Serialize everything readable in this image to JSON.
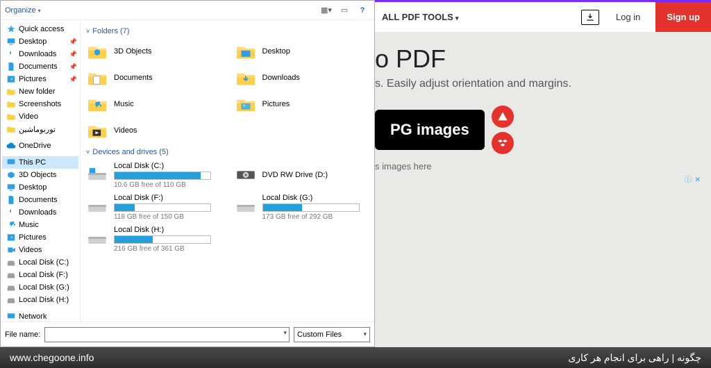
{
  "dialog": {
    "organize": "Organize",
    "view_btn": "▦",
    "preview_btn": "▭",
    "help_btn": "?",
    "nav": [
      {
        "label": "Quick access",
        "icon": "star",
        "pin": false
      },
      {
        "label": "Desktop",
        "icon": "desktop",
        "pin": true
      },
      {
        "label": "Downloads",
        "icon": "download",
        "pin": true
      },
      {
        "label": "Documents",
        "icon": "doc",
        "pin": true
      },
      {
        "label": "Pictures",
        "icon": "pic",
        "pin": true
      },
      {
        "label": "New folder",
        "icon": "folder",
        "pin": false
      },
      {
        "label": "Screenshots",
        "icon": "folder",
        "pin": false
      },
      {
        "label": "Video",
        "icon": "folder",
        "pin": false
      },
      {
        "label": "توربوماشین",
        "icon": "folder",
        "pin": false
      },
      {
        "label": "OneDrive",
        "icon": "cloud",
        "pin": false
      },
      {
        "label": "This PC",
        "icon": "pc",
        "pin": false,
        "selected": true
      },
      {
        "label": "3D Objects",
        "icon": "3d",
        "pin": false
      },
      {
        "label": "Desktop",
        "icon": "desktop",
        "pin": false
      },
      {
        "label": "Documents",
        "icon": "doc",
        "pin": false
      },
      {
        "label": "Downloads",
        "icon": "download",
        "pin": false
      },
      {
        "label": "Music",
        "icon": "music",
        "pin": false
      },
      {
        "label": "Pictures",
        "icon": "pic",
        "pin": false
      },
      {
        "label": "Videos",
        "icon": "video",
        "pin": false
      },
      {
        "label": "Local Disk (C:)",
        "icon": "drive",
        "pin": false
      },
      {
        "label": "Local Disk (F:)",
        "icon": "drive",
        "pin": false
      },
      {
        "label": "Local Disk (G:)",
        "icon": "drive",
        "pin": false
      },
      {
        "label": "Local Disk (H:)",
        "icon": "drive",
        "pin": false
      },
      {
        "label": "Network",
        "icon": "net",
        "pin": false
      }
    ],
    "folders_header": "Folders (7)",
    "folders": [
      {
        "label": "3D Objects",
        "icon": "3d"
      },
      {
        "label": "Desktop",
        "icon": "desktop-f"
      },
      {
        "label": "Documents",
        "icon": "doc-f"
      },
      {
        "label": "Downloads",
        "icon": "download-f"
      },
      {
        "label": "Music",
        "icon": "music-f"
      },
      {
        "label": "Pictures",
        "icon": "pic-f"
      },
      {
        "label": "Videos",
        "icon": "video-f"
      }
    ],
    "drives_header": "Devices and drives (5)",
    "drives": [
      {
        "name": "Local Disk (C:)",
        "free": "10.6 GB free of 110 GB",
        "pct": 90,
        "icon": "hdd-win"
      },
      {
        "name": "DVD RW Drive (D:)",
        "free": "",
        "pct": null,
        "icon": "dvd"
      },
      {
        "name": "Local Disk (F:)",
        "free": "118 GB free of 150 GB",
        "pct": 21,
        "icon": "hdd"
      },
      {
        "name": "Local Disk (G:)",
        "free": "173 GB free of 292 GB",
        "pct": 41,
        "icon": "hdd"
      },
      {
        "name": "Local Disk (H:)",
        "free": "216 GB free of 361 GB",
        "pct": 40,
        "icon": "hdd"
      }
    ],
    "file_name_label": "File name:",
    "file_name_value": "",
    "filter": "Custom Files"
  },
  "page": {
    "tools": "ALL PDF TOOLS",
    "login": "Log in",
    "signup": "Sign up",
    "title_fragment": "o PDF",
    "subtitle_fragment": "s. Easily adjust orientation and margins.",
    "cta_fragment": "PG images",
    "drop_fragment": "s images here",
    "ad_close": "ⓘ ✕"
  },
  "footer": {
    "left": "www.chegoone.info",
    "right": "چگونه | راهی برای انجام هر کاری"
  }
}
